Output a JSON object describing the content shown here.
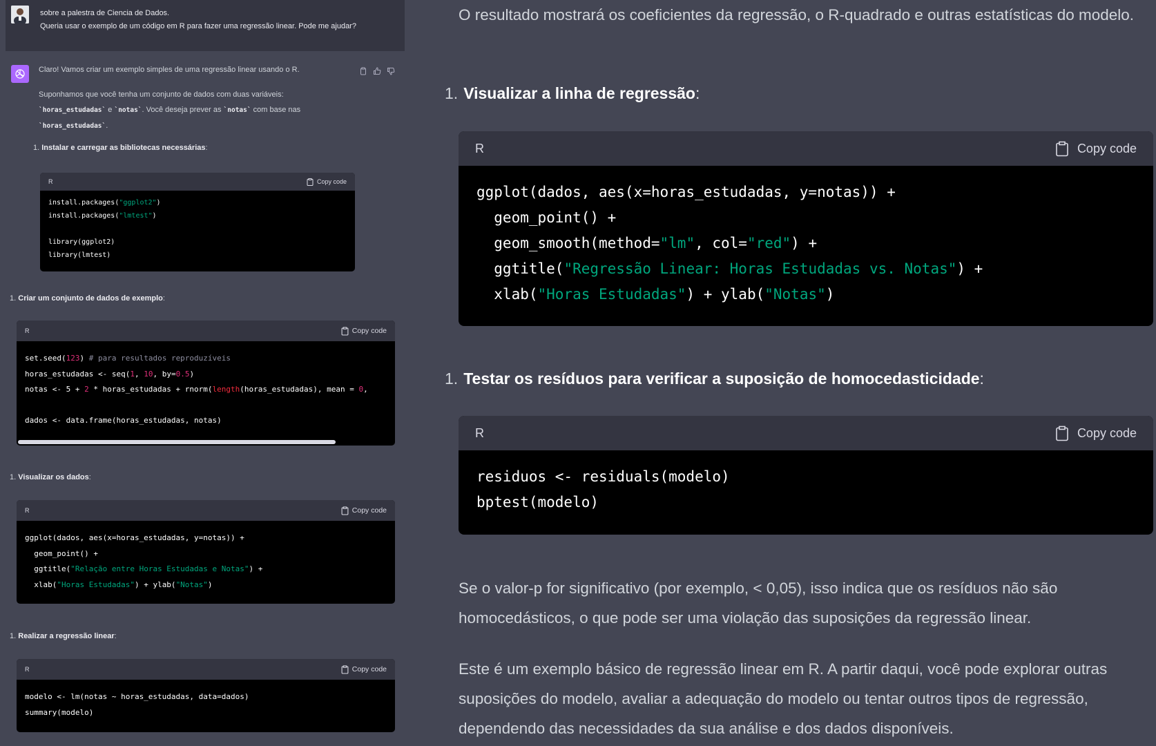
{
  "user_message": {
    "line1": "sobre a palestra de Ciencia de Dados.",
    "line2": "Queria usar o exemplo de um código em R para fazer uma regressão linear. Pode me ajudar?"
  },
  "assistant": {
    "intro": "Claro! Vamos criar um exemplo simples de uma regressão linear usando o R.",
    "para_a": "Suponhamos que você tenha um conjunto de dados com duas variáveis:",
    "code_horas": "`horas_estudadas`",
    "para_e": " e ",
    "code_notas": "`notas`",
    "para_b": ". Você deseja prever as ",
    "code_notas2": "`notas`",
    "para_c": " com base nas",
    "code_horas2": "`horas_estudadas`",
    "para_d": ".",
    "steps": [
      {
        "num": "1.",
        "title": "Instalar e carregar as bibliotecas necessárias",
        "colon": ":"
      },
      {
        "num": "1.",
        "title": "Criar um conjunto de dados de exemplo",
        "colon": ":"
      },
      {
        "num": "1.",
        "title": "Visualizar os dados",
        "colon": ":"
      },
      {
        "num": "1.",
        "title": "Realizar a regressão linear",
        "colon": ":"
      }
    ],
    "code_lang": "R",
    "copy_label": "Copy code"
  },
  "right": {
    "text_top": "O resultado mostrará os coeficientes da regressão, o R-quadrado e outras estatísticas do modelo.",
    "step_visualizar": {
      "num": "1.",
      "title": "Visualizar a linha de regressão",
      "colon": ":"
    },
    "step_testar": {
      "num": "1.",
      "title": "Testar os resíduos para verificar a suposição de homocedasticidade",
      "colon": ":"
    },
    "text_p": "Se o valor-p for significativo (por exemplo, < 0,05), isso indica que os resíduos não são homocedásticos, o que pode ser uma violação das suposições da regressão linear.",
    "text_final": "Este é um exemplo básico de regressão linear em R. A partir daqui, você pode explorar outras suposições do modelo, avaliar a adequação do modelo ou tentar outros tipos de regressão, dependendo das necessidades da sua análise e dos dados disponíveis.",
    "code_lang": "R",
    "copy_label": "Copy code"
  }
}
